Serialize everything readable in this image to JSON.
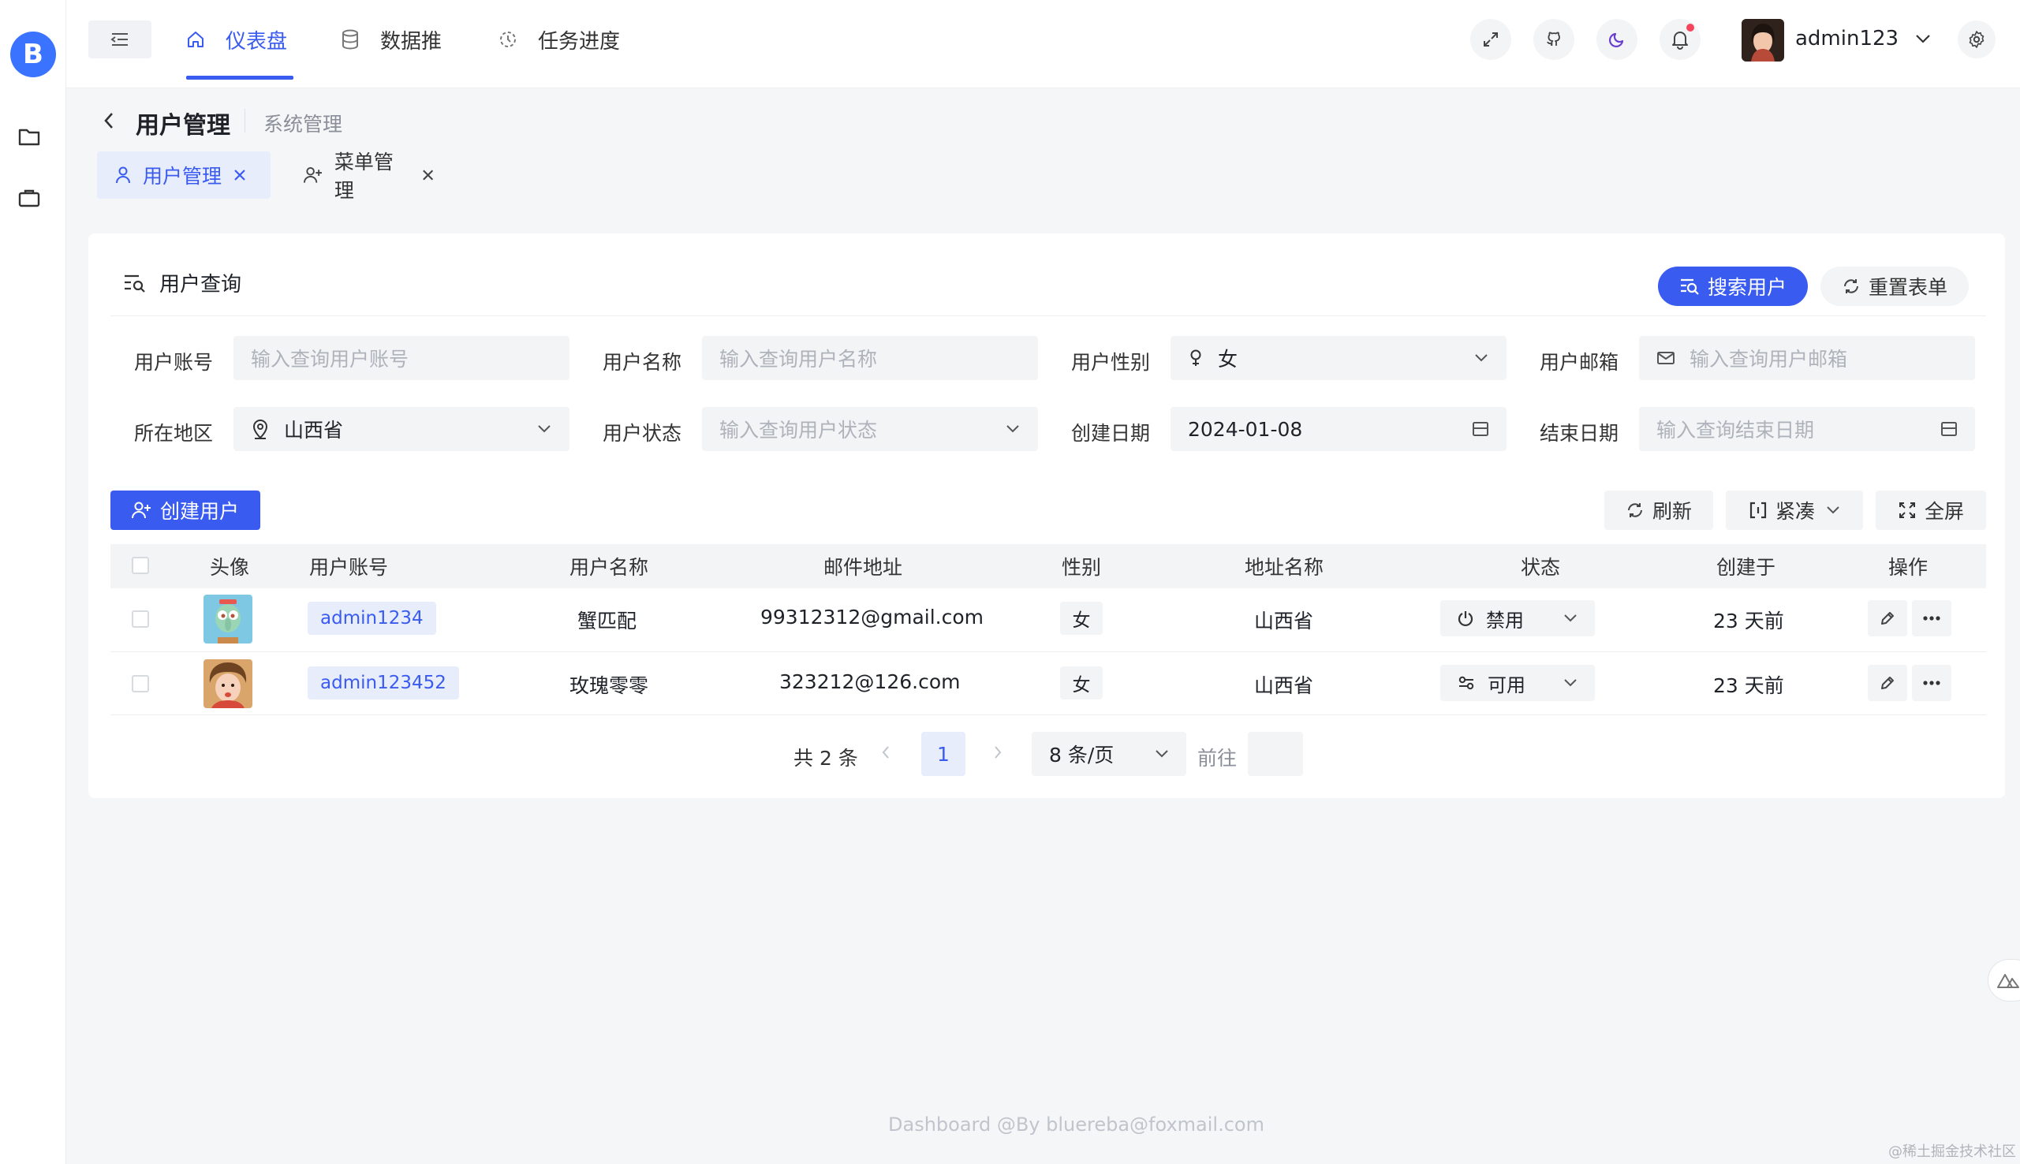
{
  "brand": {
    "logo_letter": "B"
  },
  "header": {
    "nav": [
      {
        "label": "仪表盘",
        "icon": "home-icon",
        "active": true
      },
      {
        "label": "数据推",
        "icon": "database-icon",
        "active": false
      },
      {
        "label": "任务进度",
        "icon": "progress-icon",
        "active": false
      }
    ],
    "username": "admin123"
  },
  "breadcrumb": {
    "title": "用户管理",
    "parent": "系统管理"
  },
  "tabs": [
    {
      "label": "用户管理",
      "icon": "user-icon",
      "active": true
    },
    {
      "label": "菜单管理",
      "icon": "user-plus-icon",
      "active": false
    }
  ],
  "query": {
    "title": "用户查询",
    "search_button": "搜索用户",
    "reset_button": "重置表单",
    "fields": {
      "account": {
        "label": "用户账号",
        "placeholder": "输入查询用户账号"
      },
      "name": {
        "label": "用户名称",
        "placeholder": "输入查询用户名称"
      },
      "gender": {
        "label": "用户性别",
        "value": "女"
      },
      "email": {
        "label": "用户邮箱",
        "placeholder": "输入查询用户邮箱"
      },
      "region": {
        "label": "所在地区",
        "value": "山西省"
      },
      "status": {
        "label": "用户状态",
        "placeholder": "输入查询用户状态"
      },
      "created": {
        "label": "创建日期",
        "value": "2024-01-08"
      },
      "end": {
        "label": "结束日期",
        "placeholder": "输入查询结束日期"
      }
    }
  },
  "toolbar": {
    "create_button": "创建用户",
    "refresh_button": "刷新",
    "density_button": "紧凑",
    "fullscreen_button": "全屏"
  },
  "table": {
    "columns": [
      "头像",
      "用户账号",
      "用户名称",
      "邮件地址",
      "性别",
      "地址名称",
      "状态",
      "创建于",
      "操作"
    ],
    "rows": [
      {
        "account": "admin1234",
        "name": "蟹匹配",
        "email": "99312312@gmail.com",
        "gender": "女",
        "address": "山西省",
        "status": "禁用",
        "created": "23 天前"
      },
      {
        "account": "admin123452",
        "name": "玫瑰零零",
        "email": "323212@126.com",
        "gender": "女",
        "address": "山西省",
        "status": "可用",
        "created": "23 天前"
      }
    ]
  },
  "pagination": {
    "total": "共 2 条",
    "current": "1",
    "page_size": "8 条/页",
    "goto": "前往"
  },
  "footer": {
    "text": "Dashboard @By bluereba@foxmail.com",
    "watermark": "@稀土掘金技术社区"
  },
  "colors": {
    "accent": "#3a5bf0",
    "accent_soft": "#e8edfb",
    "field_bg": "#f3f4f6",
    "logo": "#3a73ff",
    "notify": "#f5455c"
  }
}
